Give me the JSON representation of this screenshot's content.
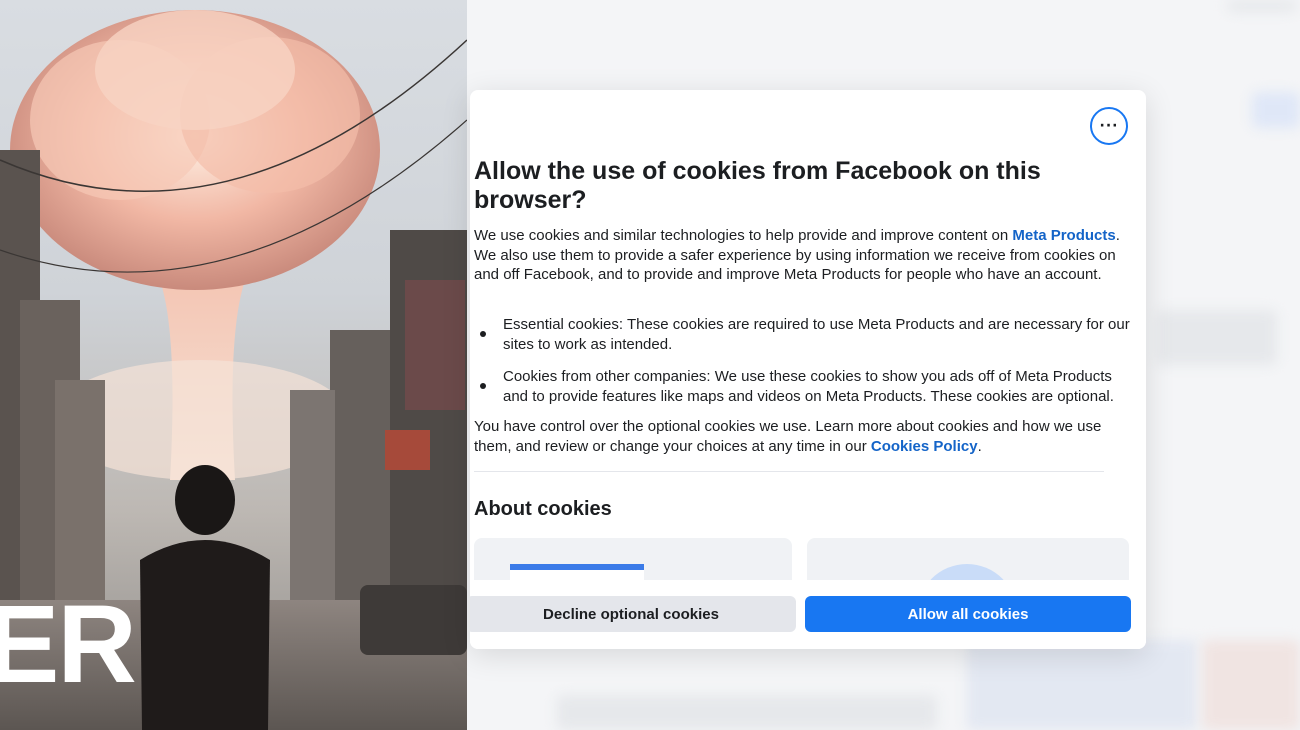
{
  "thumbnail": {
    "overlay_text": "ER"
  },
  "dialog": {
    "title": "Allow the use of cookies from Facebook on this browser?",
    "intro_1": "We use cookies and similar technologies to help provide and improve content on ",
    "intro_link": "Meta Products",
    "intro_2": ". We also use them to provide a safer experience by using information we receive from cookies on and off Facebook, and to provide and improve Meta Products for people who have an account.",
    "bullets": [
      "Essential cookies: These cookies are required to use Meta Products and are necessary for our sites to work as intended.",
      "Cookies from other companies: We use these cookies to show you ads off of Meta Products and to provide features like maps and videos on Meta Products. These cookies are optional."
    ],
    "control_1": "You have control over the optional cookies we use. Learn more about cookies and how we use them, and review or change your choices at any time in our ",
    "control_link": "Cookies Policy",
    "control_2": ".",
    "about_heading": "About cookies",
    "more_icon": "more-horizontal-icon",
    "more_glyph": "···",
    "decline_label": "Decline optional cookies",
    "allow_label": "Allow all cookies"
  },
  "colors": {
    "accent": "#1877f2",
    "link": "#1464c8",
    "text": "#1c1e21",
    "secondary_button": "#e4e6eb"
  }
}
